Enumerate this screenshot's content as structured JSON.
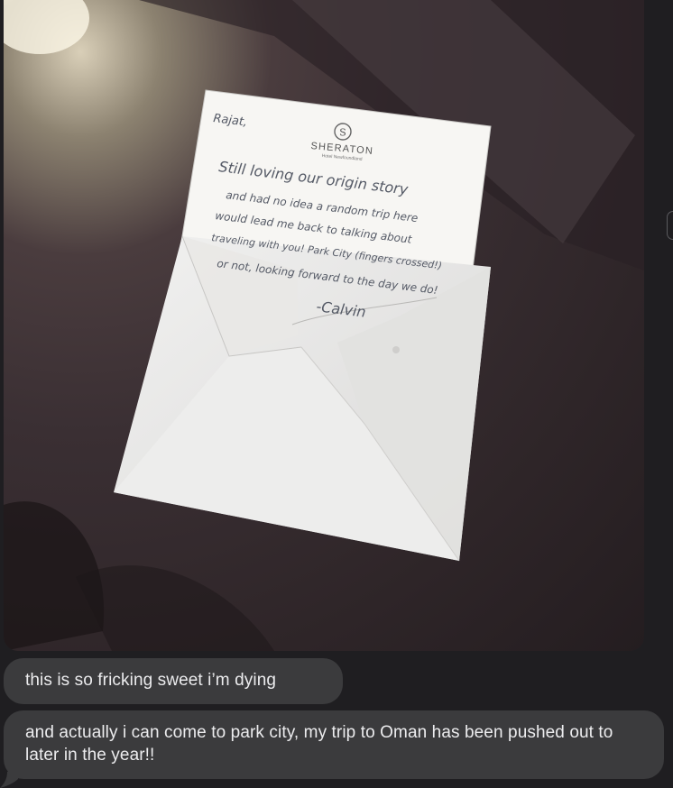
{
  "photo": {
    "letterhead": {
      "brand": "SHERATON",
      "subtitle": "Hotel Newfoundland",
      "logo_letter": "S"
    },
    "note_lines": [
      "Rajat,",
      "Still loving our origin story",
      "and had no idea a random trip here",
      "would lead me back to talking about",
      "traveling with you! Park City (fingers crossed!)",
      "or not, looking forward to the day we do!",
      "-Calvin"
    ]
  },
  "messages": [
    {
      "text": "this is so fricking sweet i’m dying"
    },
    {
      "text": "and actually i can come to park city, my trip to Oman has been pushed out to later in the year!!"
    }
  ],
  "colors": {
    "bubble": "#3b3b3d",
    "text": "#ececee",
    "background": "#1f1e21"
  }
}
